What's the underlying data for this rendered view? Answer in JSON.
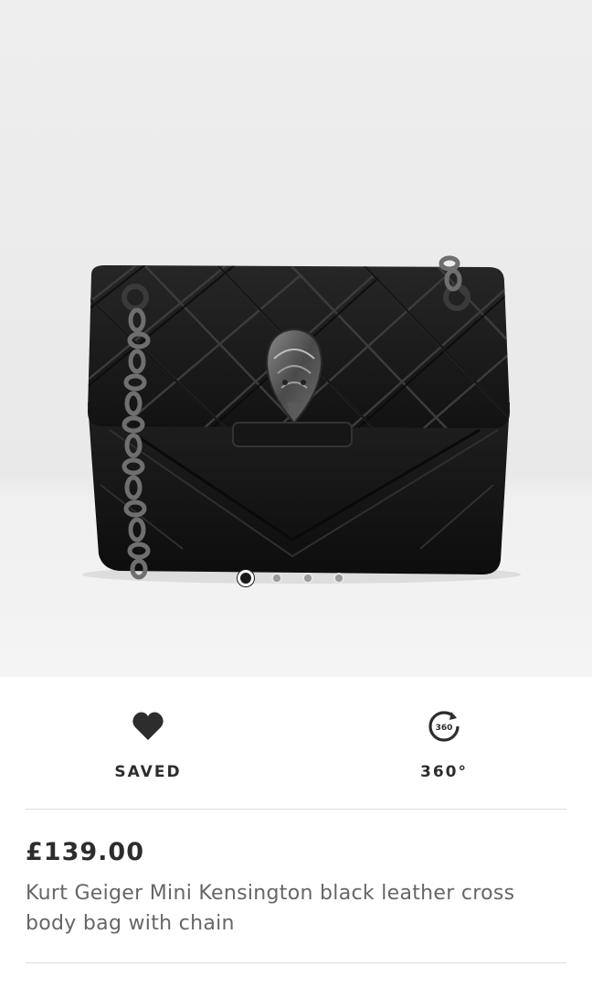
{
  "gallery": {
    "image_alt": "Kurt Geiger Mini Kensington black leather cross body bag with chain",
    "dots": [
      {
        "active": true
      },
      {
        "active": false
      },
      {
        "active": false
      },
      {
        "active": false
      }
    ]
  },
  "actions": {
    "save": {
      "label": "SAVED",
      "icon": "heart-icon"
    },
    "view360": {
      "label": "360°",
      "icon": "rotate-360-icon",
      "icon_text": "360"
    }
  },
  "product": {
    "price": "£139.00",
    "name": "Kurt Geiger Mini Kensington black leather cross body bag with chain"
  }
}
